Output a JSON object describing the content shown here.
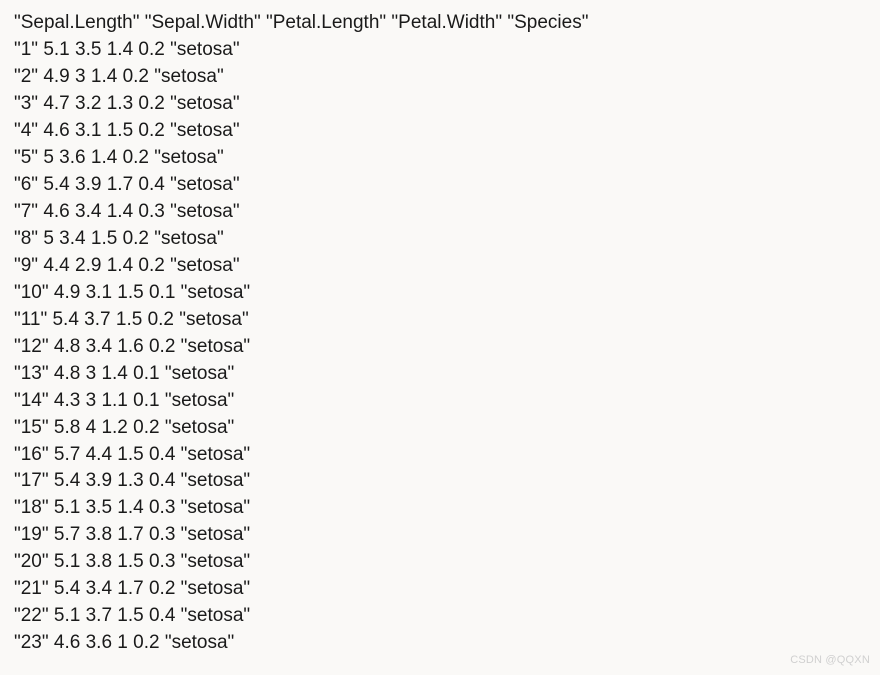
{
  "header": {
    "columns": [
      "Sepal.Length",
      "Sepal.Width",
      "Petal.Length",
      "Petal.Width",
      "Species"
    ]
  },
  "rows": [
    {
      "idx": "1",
      "sepal_length": "5.1",
      "sepal_width": "3.5",
      "petal_length": "1.4",
      "petal_width": "0.2",
      "species": "setosa"
    },
    {
      "idx": "2",
      "sepal_length": "4.9",
      "sepal_width": "3",
      "petal_length": "1.4",
      "petal_width": "0.2",
      "species": "setosa"
    },
    {
      "idx": "3",
      "sepal_length": "4.7",
      "sepal_width": "3.2",
      "petal_length": "1.3",
      "petal_width": "0.2",
      "species": "setosa"
    },
    {
      "idx": "4",
      "sepal_length": "4.6",
      "sepal_width": "3.1",
      "petal_length": "1.5",
      "petal_width": "0.2",
      "species": "setosa"
    },
    {
      "idx": "5",
      "sepal_length": "5",
      "sepal_width": "3.6",
      "petal_length": "1.4",
      "petal_width": "0.2",
      "species": "setosa"
    },
    {
      "idx": "6",
      "sepal_length": "5.4",
      "sepal_width": "3.9",
      "petal_length": "1.7",
      "petal_width": "0.4",
      "species": "setosa"
    },
    {
      "idx": "7",
      "sepal_length": "4.6",
      "sepal_width": "3.4",
      "petal_length": "1.4",
      "petal_width": "0.3",
      "species": "setosa"
    },
    {
      "idx": "8",
      "sepal_length": "5",
      "sepal_width": "3.4",
      "petal_length": "1.5",
      "petal_width": "0.2",
      "species": "setosa"
    },
    {
      "idx": "9",
      "sepal_length": "4.4",
      "sepal_width": "2.9",
      "petal_length": "1.4",
      "petal_width": "0.2",
      "species": "setosa"
    },
    {
      "idx": "10",
      "sepal_length": "4.9",
      "sepal_width": "3.1",
      "petal_length": "1.5",
      "petal_width": "0.1",
      "species": "setosa"
    },
    {
      "idx": "11",
      "sepal_length": "5.4",
      "sepal_width": "3.7",
      "petal_length": "1.5",
      "petal_width": "0.2",
      "species": "setosa"
    },
    {
      "idx": "12",
      "sepal_length": "4.8",
      "sepal_width": "3.4",
      "petal_length": "1.6",
      "petal_width": "0.2",
      "species": "setosa"
    },
    {
      "idx": "13",
      "sepal_length": "4.8",
      "sepal_width": "3",
      "petal_length": "1.4",
      "petal_width": "0.1",
      "species": "setosa"
    },
    {
      "idx": "14",
      "sepal_length": "4.3",
      "sepal_width": "3",
      "petal_length": "1.1",
      "petal_width": "0.1",
      "species": "setosa"
    },
    {
      "idx": "15",
      "sepal_length": "5.8",
      "sepal_width": "4",
      "petal_length": "1.2",
      "petal_width": "0.2",
      "species": "setosa"
    },
    {
      "idx": "16",
      "sepal_length": "5.7",
      "sepal_width": "4.4",
      "petal_length": "1.5",
      "petal_width": "0.4",
      "species": "setosa"
    },
    {
      "idx": "17",
      "sepal_length": "5.4",
      "sepal_width": "3.9",
      "petal_length": "1.3",
      "petal_width": "0.4",
      "species": "setosa"
    },
    {
      "idx": "18",
      "sepal_length": "5.1",
      "sepal_width": "3.5",
      "petal_length": "1.4",
      "petal_width": "0.3",
      "species": "setosa"
    },
    {
      "idx": "19",
      "sepal_length": "5.7",
      "sepal_width": "3.8",
      "petal_length": "1.7",
      "petal_width": "0.3",
      "species": "setosa"
    },
    {
      "idx": "20",
      "sepal_length": "5.1",
      "sepal_width": "3.8",
      "petal_length": "1.5",
      "petal_width": "0.3",
      "species": "setosa"
    },
    {
      "idx": "21",
      "sepal_length": "5.4",
      "sepal_width": "3.4",
      "petal_length": "1.7",
      "petal_width": "0.2",
      "species": "setosa"
    },
    {
      "idx": "22",
      "sepal_length": "5.1",
      "sepal_width": "3.7",
      "petal_length": "1.5",
      "petal_width": "0.4",
      "species": "setosa"
    },
    {
      "idx": "23",
      "sepal_length": "4.6",
      "sepal_width": "3.6",
      "petal_length": "1",
      "petal_width": "0.2",
      "species": "setosa"
    }
  ],
  "watermark": "CSDN @QQXN"
}
